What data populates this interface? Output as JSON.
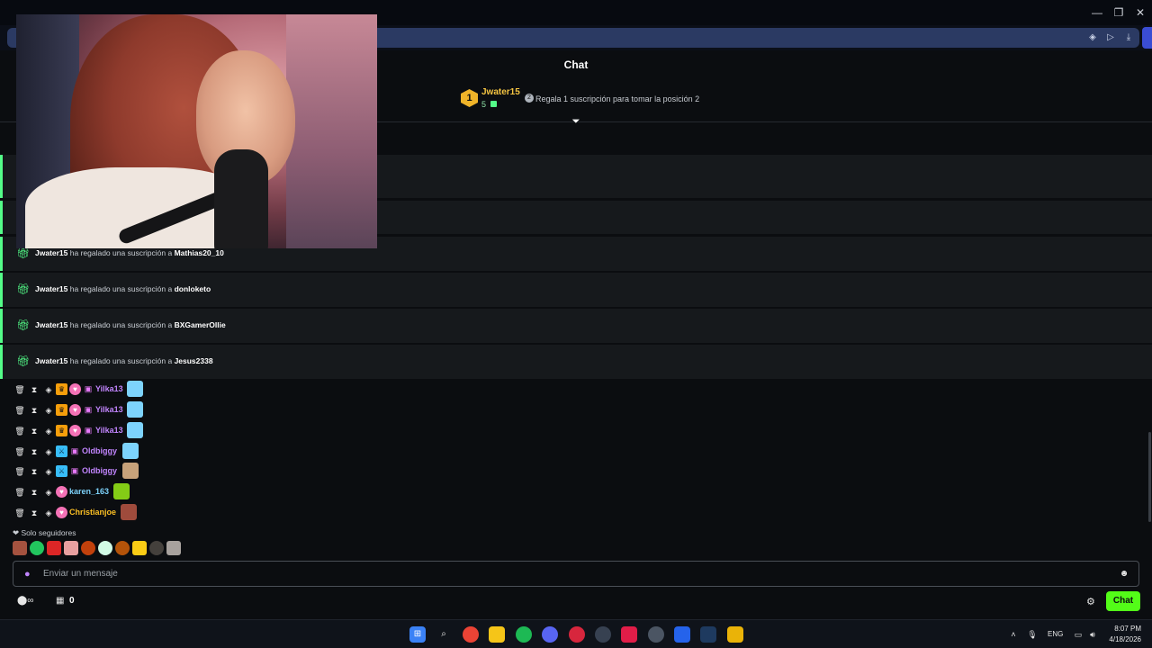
{
  "window": {
    "controls": [
      "—",
      "❐",
      "✕"
    ]
  },
  "chat": {
    "title": "Chat"
  },
  "leaderboard": {
    "rank": "1",
    "name": "Jwater15",
    "count": "5",
    "hint": "Regala 1 suscripción para tomar la posición 2"
  },
  "gift_events": [
    {
      "gifter": "Jwater15",
      "text": "ha regalado una suscripción a",
      "recipient": "Mathias20_10"
    },
    {
      "gifter": "Jwater15",
      "text": "ha regalado una suscripción a",
      "recipient": "donloketo"
    },
    {
      "gifter": "Jwater15",
      "text": "ha regalado una suscripción a",
      "recipient": "BXGamerOllie"
    },
    {
      "gifter": "Jwater15",
      "text": "ha regalado una suscripción a",
      "recipient": "Jesus2338"
    }
  ],
  "messages": [
    {
      "user": "Yilka13",
      "color": "#c084fc",
      "emote": "#7dd3fc"
    },
    {
      "user": "Yilka13",
      "color": "#c084fc",
      "emote": "#7dd3fc"
    },
    {
      "user": "Yilka13",
      "color": "#c084fc",
      "emote": "#7dd3fc"
    },
    {
      "user": "Oldbiggy",
      "color": "#c084fc",
      "emote": "#7dd3fc"
    },
    {
      "user": "Oldbiggy",
      "color": "#c084fc",
      "emote": "#c8a27a"
    },
    {
      "user": "karen_163",
      "color": "#7dd3fc",
      "emote": "#84cc16"
    },
    {
      "user": "Christianjoe",
      "color": "#fbbf24",
      "emote": "#9f4b3c"
    }
  ],
  "followers_only": "❤ Solo seguidores",
  "input": {
    "placeholder": "Enviar un mensaje"
  },
  "footer": {
    "store_count": "0",
    "chat_button": "Chat"
  },
  "taskbar": {
    "language": "ENG",
    "time": "8:07 PM",
    "date": "4/18/2026"
  },
  "colors": {
    "accent": "#53fc18",
    "pinned_border": "#53fc88",
    "leader_gold": "#f0b429"
  }
}
